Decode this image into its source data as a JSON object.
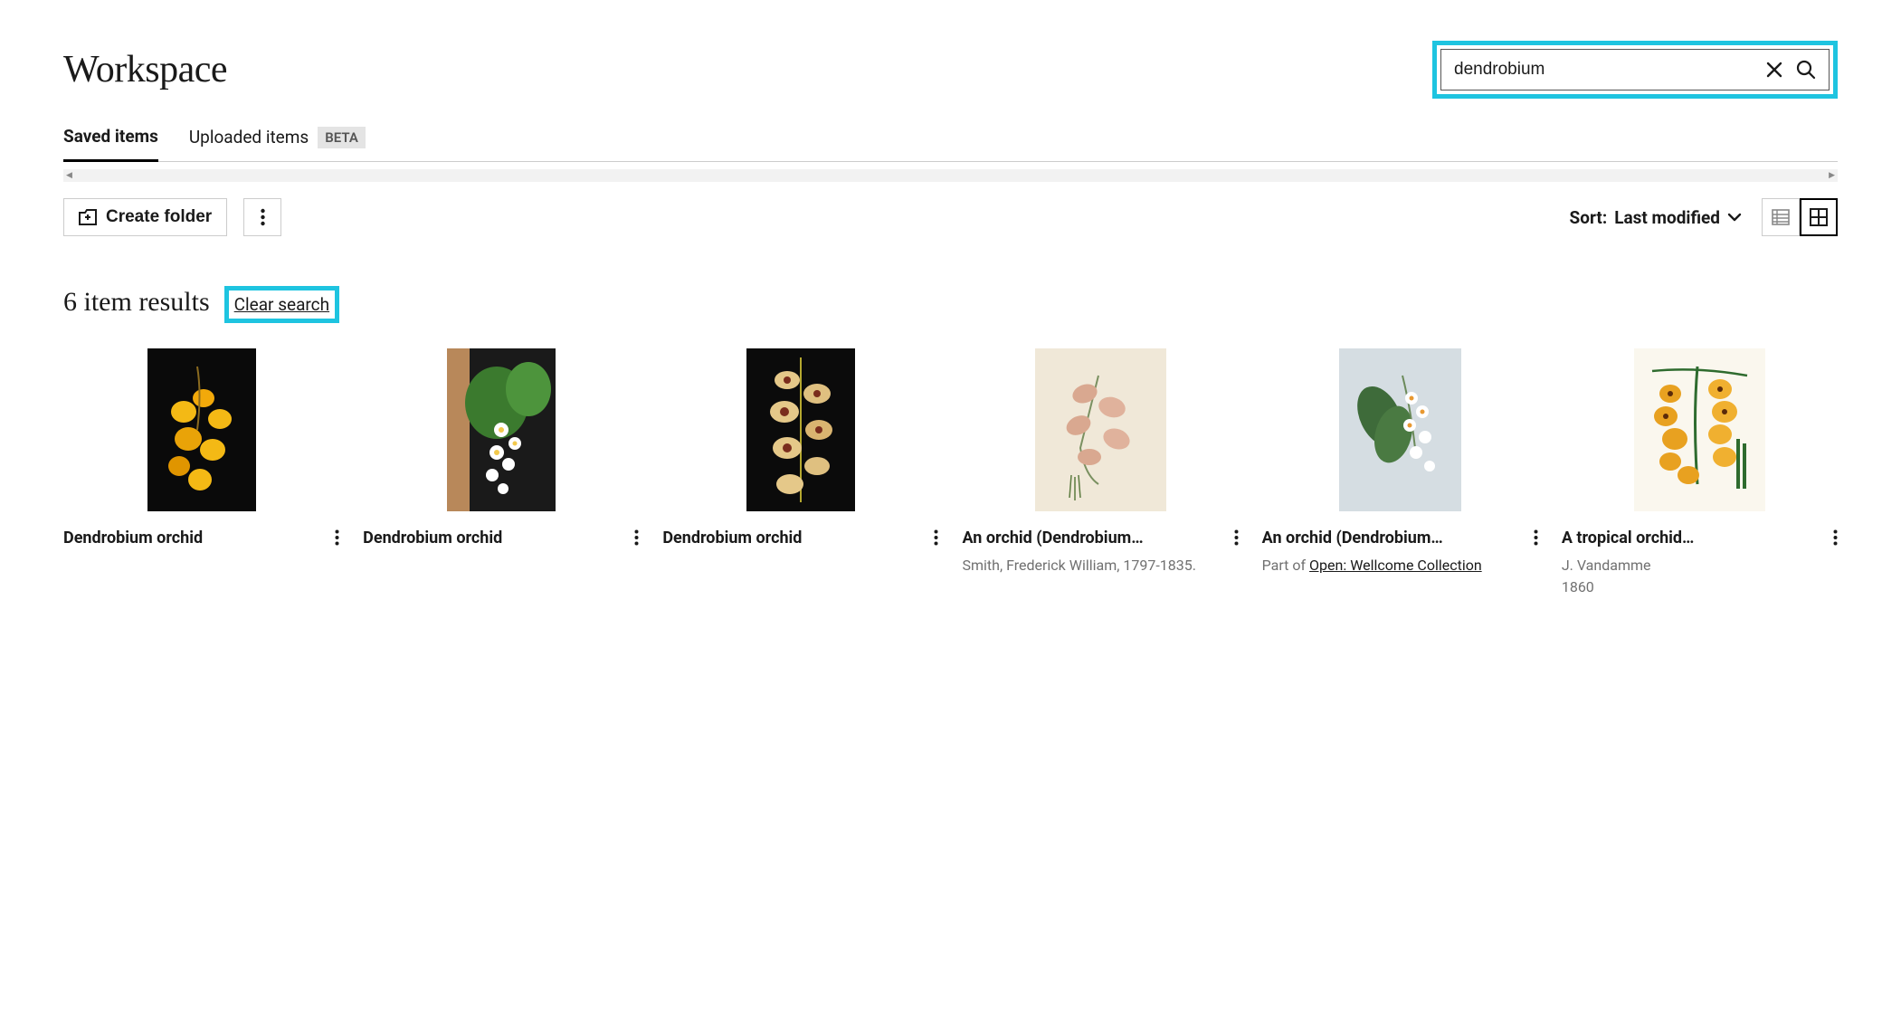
{
  "page_title": "Workspace",
  "search": {
    "value": "dendrobium"
  },
  "tabs": [
    {
      "label": "Saved items",
      "active": true
    },
    {
      "label": "Uploaded items",
      "active": false,
      "badge": "BETA"
    }
  ],
  "toolbar": {
    "create_folder_label": "Create folder",
    "sort_label": "Sort:",
    "sort_value": "Last modified"
  },
  "results": {
    "count_text": "6 item results",
    "clear_label": "Clear search"
  },
  "items": [
    {
      "title": "Dendrobium orchid",
      "byline": "",
      "partof_prefix": "",
      "partof_link": "",
      "date": "",
      "thumb_style": "photo-yellow"
    },
    {
      "title": "Dendrobium orchid",
      "byline": "",
      "partof_prefix": "",
      "partof_link": "",
      "date": "",
      "thumb_style": "photo-white"
    },
    {
      "title": "Dendrobium orchid",
      "byline": "",
      "partof_prefix": "",
      "partof_link": "",
      "date": "",
      "thumb_style": "photo-tan"
    },
    {
      "title": "An orchid (Dendrobium…",
      "byline": "Smith, Frederick William, 1797-1835.",
      "partof_prefix": "",
      "partof_link": "",
      "date": "",
      "thumb_style": "illus-pink"
    },
    {
      "title": "An orchid (Dendrobium…",
      "byline": "",
      "partof_prefix": "Part of ",
      "partof_link": "Open: Wellcome Collection",
      "date": "",
      "thumb_style": "illus-whiteleaf"
    },
    {
      "title": "A tropical orchid…",
      "byline": "J. Vandamme",
      "partof_prefix": "",
      "partof_link": "",
      "date": "1860",
      "thumb_style": "illus-gold"
    }
  ]
}
